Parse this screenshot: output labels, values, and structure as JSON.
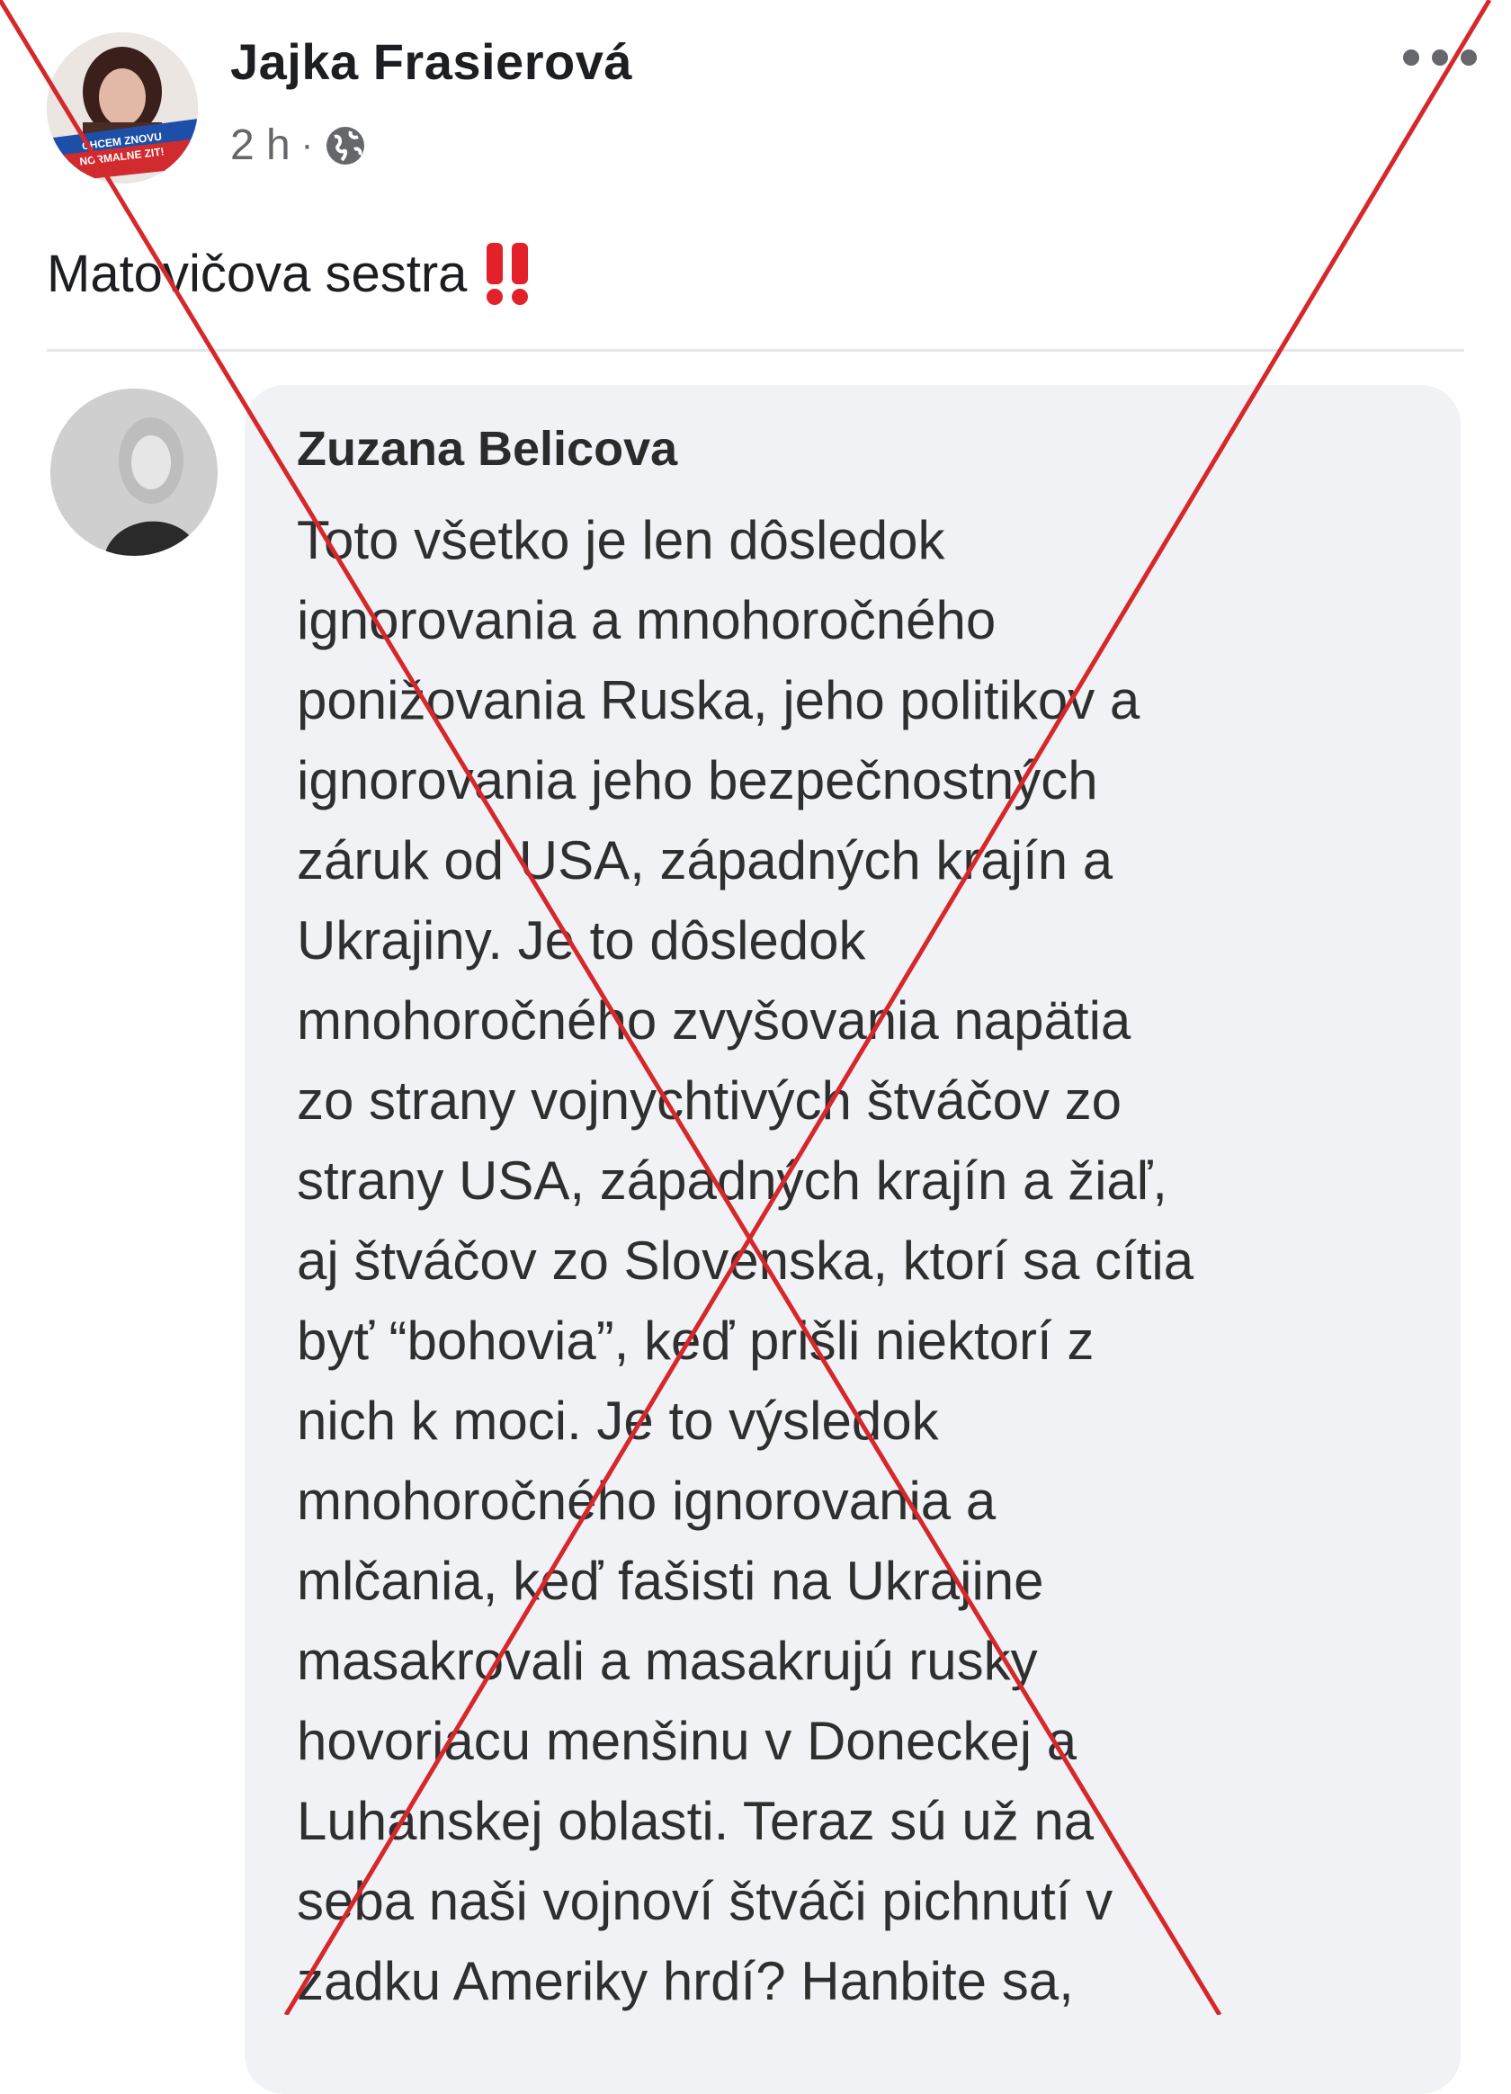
{
  "post": {
    "author": "Jajka Frasierová",
    "time": "2 h",
    "separator": "·",
    "text": "Matovičova sestra",
    "avatar_badge_text": "CHCEM ZNOVU NORMALNE ZIT!"
  },
  "icons": {
    "globe": "globe-icon",
    "more": "more-options-icon",
    "exclamation": "double-exclamation-icon"
  },
  "comment": {
    "author": "Zuzana Belicova",
    "lines": [
      "Toto všetko je len dôsledok",
      "ignorovania a mnohoročného",
      "ponižovania Ruska, jeho politikov  a",
      "ignorovania jeho bezpečnostných",
      "záruk od USA, západných krajín a",
      "Ukrajiny. Je to dôsledok",
      "mnohoročného zvyšovania napätia",
      "zo strany vojnychtivých štváčov zo",
      "strany USA, západných krajín a žiaľ,",
      "aj štváčov zo Slovenska, ktorí sa cítia",
      "byť “bohovia”, keď prišli niektorí z",
      "nich k moci. Je to výsledok",
      "mnohoročného ignorovania a",
      "mlčania, keď fašisti  na Ukrajine",
      "masakrovali a masakrujú rusky",
      "hovoriacu menšinu v Doneckej a",
      "Luhanskej oblasti. Teraz sú už na",
      "seba naši vojnoví štváči pichnutí v",
      "zadku Ameriky hrdí? Hanbite sa,"
    ]
  },
  "colors": {
    "cross": "#d6282b",
    "bubble": "#f0f2f5",
    "meta": "#65676b"
  }
}
